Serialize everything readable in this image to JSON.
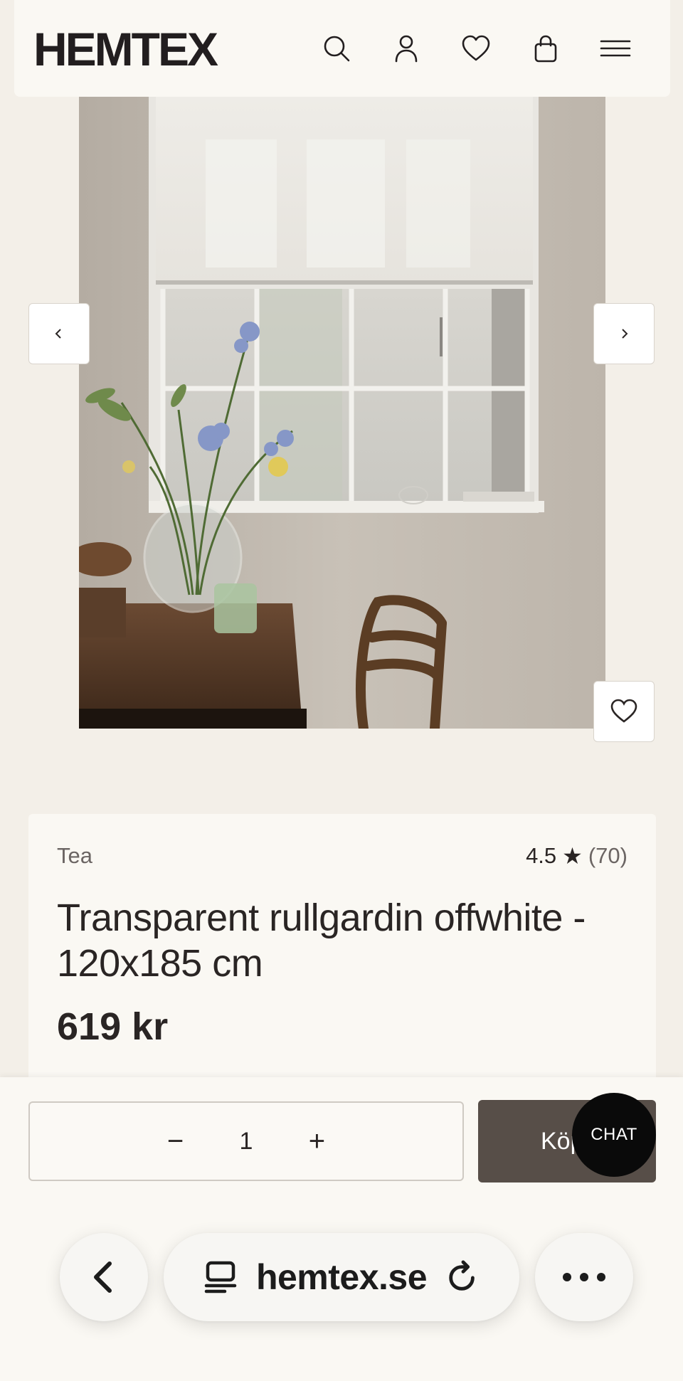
{
  "header": {
    "logo": "HEMTEX",
    "icons": [
      "search-icon",
      "account-icon",
      "wishlist-icon",
      "bag-icon",
      "menu-icon"
    ]
  },
  "gallery": {
    "prev_icon": "chevron-left-icon",
    "next_icon": "chevron-right-icon",
    "favorite_icon": "heart-icon"
  },
  "product": {
    "color": "Tea",
    "rating": "4.5",
    "rating_star": "★",
    "review_count": "(70)",
    "title": "Transparent rullgardin offwhite - 120x185 cm",
    "price": "619 kr"
  },
  "purchase": {
    "minus": "−",
    "quantity": "1",
    "plus": "+",
    "buy_label": "Köp",
    "chat_label": "CHAT"
  },
  "browser": {
    "url": "hemtex.se",
    "back_icon": "back-arrow-icon",
    "tabs_icon": "tabs-icon",
    "reload_icon": "reload-icon",
    "more_icon": "more-dots-icon"
  },
  "colors": {
    "background": "#f3efe8",
    "card": "#faf8f3",
    "buy_button": "#574e48",
    "chat_button": "#0a0a0a"
  }
}
